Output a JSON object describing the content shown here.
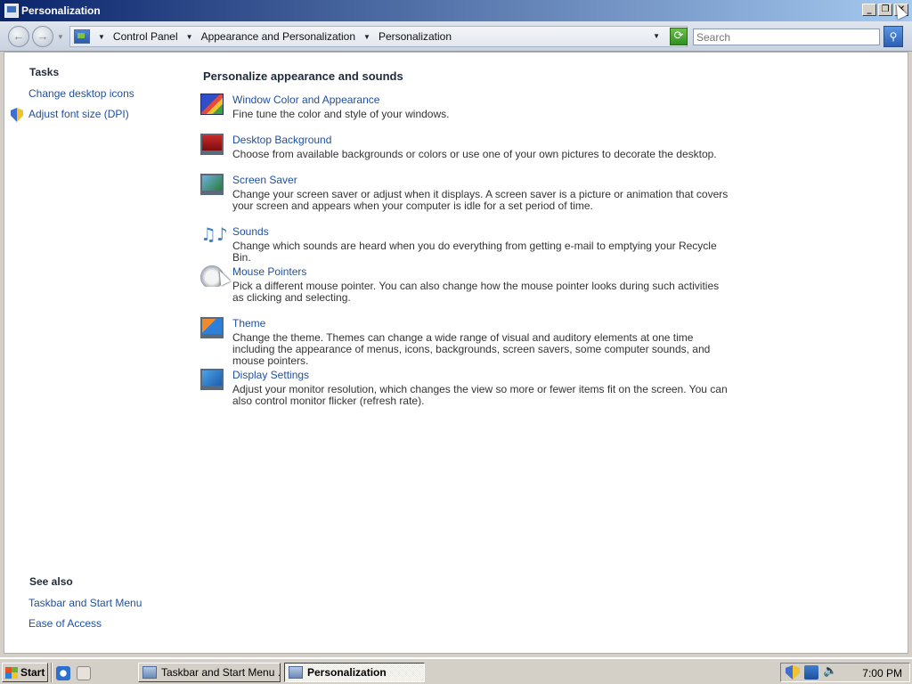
{
  "window": {
    "title": "Personalization",
    "minimize_label": "_",
    "restore_label": "❐",
    "close_label": "✕"
  },
  "address": {
    "back_label": "←",
    "forward_label": "→",
    "breadcrumbs": [
      "Control Panel",
      "Appearance and Personalization",
      "Personalization"
    ],
    "refresh_label": "⟳",
    "search_placeholder": "Search",
    "search_button_label": "⚲"
  },
  "tasks": {
    "heading": "Tasks",
    "links": [
      "Change desktop icons",
      "Adjust font size (DPI)"
    ]
  },
  "see_also": {
    "heading": "See also",
    "links": [
      "Taskbar and Start Menu",
      "Ease of Access"
    ]
  },
  "main": {
    "heading": "Personalize appearance and sounds",
    "items": [
      {
        "title": "Window Color and Appearance",
        "desc": "Fine tune the color and style of your windows.",
        "icon": "window-color-icon"
      },
      {
        "title": "Desktop Background",
        "desc": "Choose from available backgrounds or colors or use one of your own pictures to decorate the desktop.",
        "icon": "desktop-background-icon"
      },
      {
        "title": "Screen Saver",
        "desc": "Change your screen saver or adjust when it displays. A screen saver is a picture or animation that covers your screen and appears when your computer is idle for a set period of time.",
        "icon": "screen-saver-icon"
      },
      {
        "title": "Sounds",
        "desc": "Change which sounds are heard when you do everything from getting e-mail to emptying your Recycle Bin.",
        "icon": "sounds-icon"
      },
      {
        "title": "Mouse Pointers",
        "desc": "Pick a different mouse pointer. You can also change how the mouse pointer looks during such activities as clicking and selecting.",
        "icon": "mouse-pointers-icon"
      },
      {
        "title": "Theme",
        "desc": "Change the theme. Themes can change a wide range of visual and auditory elements at one time including the appearance of menus, icons, backgrounds, screen savers, some computer sounds, and mouse pointers.",
        "icon": "theme-icon"
      },
      {
        "title": "Display Settings",
        "desc": "Adjust your monitor resolution, which changes the view so more or fewer items fit on the screen. You can also control monitor flicker (refresh rate).",
        "icon": "display-settings-icon"
      }
    ]
  },
  "taskbar": {
    "start_label": "Start",
    "tasks": [
      "Taskbar and Start Menu ...",
      "Personalization"
    ],
    "clock": "7:00 PM"
  }
}
